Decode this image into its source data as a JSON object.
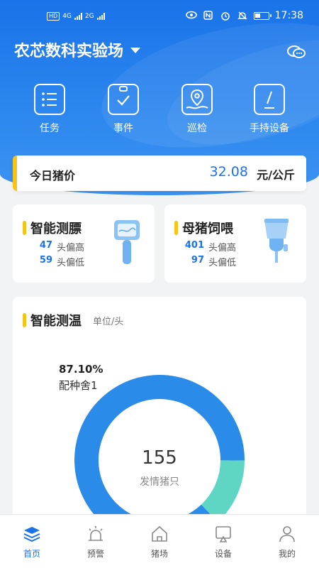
{
  "status_bar": {
    "time": "17:38",
    "network_chip": "HD",
    "network_labels": [
      "4G",
      "2G"
    ]
  },
  "header": {
    "farm_name": "农芯数科实验场"
  },
  "quick_actions": [
    {
      "label": "任务",
      "icon": "list-icon"
    },
    {
      "label": "事件",
      "icon": "clipboard-check-icon"
    },
    {
      "label": "巡检",
      "icon": "map-pin-icon"
    },
    {
      "label": "手持设备",
      "icon": "handheld-device-icon"
    }
  ],
  "pig_price": {
    "label": "今日猪价",
    "value": "32.08",
    "unit": "元/公斤"
  },
  "backfat_card": {
    "title": "智能测膘",
    "rows": [
      {
        "count": "47",
        "text": "头偏高"
      },
      {
        "count": "59",
        "text": "头偏低"
      }
    ]
  },
  "feeding_card": {
    "title": "母猪饲喂",
    "rows": [
      {
        "count": "401",
        "text": "头偏高"
      },
      {
        "count": "97",
        "text": "头偏低"
      }
    ]
  },
  "temperature_card": {
    "title": "智能测温",
    "unit": "单位/头",
    "callout_percent": "87.10%",
    "callout_label": "配种舍1",
    "center_value": "155",
    "center_label": "发情猪只"
  },
  "chart_data": {
    "type": "pie",
    "donut": true,
    "center_value": 155,
    "center_label": "发情猪只",
    "slices": [
      {
        "label": "配种舍1",
        "percent": 87.1,
        "color": "#2a8be9"
      },
      {
        "label": "",
        "percent": 12.9,
        "color": "#5fd6c4"
      }
    ]
  },
  "bottom_nav": [
    {
      "label": "首页",
      "icon": "layers-icon",
      "active": true
    },
    {
      "label": "预警",
      "icon": "alarm-icon",
      "active": false
    },
    {
      "label": "猪场",
      "icon": "house-icon",
      "active": false
    },
    {
      "label": "设备",
      "icon": "device-icon",
      "active": false
    },
    {
      "label": "我的",
      "icon": "user-icon",
      "active": false
    }
  ],
  "colors": {
    "primary": "#1a73e8",
    "accent_yellow": "#f6c318",
    "donut_main": "#2a8be9",
    "donut_secondary": "#5fd6c4"
  }
}
